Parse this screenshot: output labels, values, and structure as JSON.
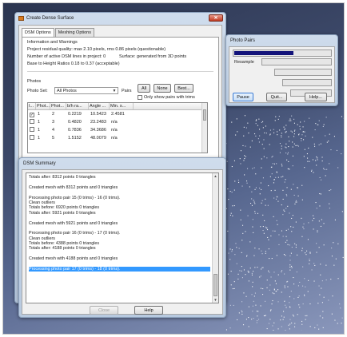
{
  "colors": {
    "accent": "#3399ff",
    "progress_fill": "#14147a",
    "close_button": "#c23b22",
    "desktop_background": "#3c4868"
  },
  "main_window": {
    "title": "Create Dense Surface",
    "close_icon": "close-icon",
    "tabs": [
      {
        "label": "DSM Options",
        "active": true
      },
      {
        "label": "Meshing Options",
        "active": false
      }
    ],
    "info": {
      "heading": "Information and Warnings",
      "residual": "Project residual quality: max 2.10 pixels, rms 0.86 pixels (questionable)",
      "active_dsm_left": "Number of active DSM lines in project: 0",
      "active_dsm_right": "Surface: generated from 3D points",
      "base_height": "Base to Height Ratios 0.18 to 0.37 (acceptable)"
    },
    "photos": {
      "heading": "Photos",
      "photo_set_label": "Photo Set:",
      "photo_set_value": "All Photos",
      "pairs_label": "Pairs",
      "btn_all": "All",
      "btn_none": "None",
      "btn_best": "Best...",
      "only_show_label": "Only show pairs with trims"
    },
    "grid": {
      "columns": [
        "I...",
        "Phot...",
        "Phot...",
        "b/h ra...",
        "Angle ...",
        "Min. s..."
      ],
      "rows": [
        {
          "checked": true,
          "cells": [
            "1",
            "2",
            "0.2219",
            "10.5423",
            "2.4581"
          ]
        },
        {
          "checked": false,
          "cells": [
            "1",
            "3",
            "0.4820",
            "23.2483",
            "n/a"
          ]
        },
        {
          "checked": false,
          "cells": [
            "1",
            "4",
            "0.7836",
            "34.3686",
            "n/a"
          ]
        },
        {
          "checked": false,
          "cells": [
            "1",
            "5",
            "1.5152",
            "48.0079",
            "n/a"
          ]
        }
      ]
    }
  },
  "summary_window": {
    "title": "DSM Summary",
    "log_lines": [
      "Totals after: 8312 points 0 triangles",
      "",
      "Created mesh with 8312 points and 0 triangles",
      "",
      "Processing photo pair 15 (0 trims) - 16 (0 trims).",
      "Clean outliers",
      "Totals before: 6920 points 0 triangles",
      "Totals after: 5921 points 0 triangles",
      "",
      "Created mesh with 5921 points and 0 triangles",
      "",
      "Processing photo pair 16 (0 trims) - 17 (0 trims).",
      "Clean outliers",
      "Totals before: 4388 points 0 triangles",
      "Totals after: 4188 points 0 triangles",
      "",
      "Created mesh with 4188 points and 0 triangles",
      "",
      "Processing photo pair 17 (0 trims) - 18 (0 trims)."
    ],
    "selected_index": 18,
    "btn_close": "Close",
    "btn_help": "Help"
  },
  "pairs_window": {
    "title": "Photo Pairs",
    "resample_label": "Resample",
    "progress": [
      0.62,
      0.0,
      0.0,
      0.0,
      0.0
    ],
    "btn_pause": "Pause",
    "btn_quit": "Quit...",
    "btn_help": "Help..."
  }
}
